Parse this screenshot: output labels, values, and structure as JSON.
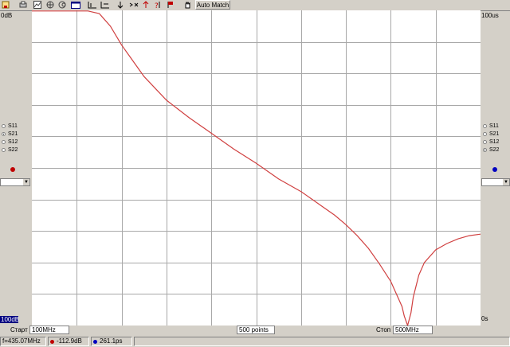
{
  "toolbar": {
    "auto_match_label": "Auto Match",
    "icons": [
      "save-icon",
      "print-icon",
      "chart-icon",
      "polar-icon",
      "smith-icon",
      "table-icon",
      "marker-icon",
      "marker-alt-icon",
      "arrow-down-icon",
      "arrow-cross-icon",
      "arrow-up-icon",
      "help-icon",
      "flag-icon",
      "hand-icon"
    ]
  },
  "left_axis": {
    "top_label": "0dB",
    "bottom_label": "100dB"
  },
  "right_axis": {
    "top_label": "100us",
    "bottom_label": "0s"
  },
  "left_params": {
    "items": [
      "S11",
      "S21",
      "S12",
      "S22"
    ],
    "selected": "S21",
    "marker_color": "#c00000"
  },
  "right_params": {
    "items": [
      "S11",
      "S21",
      "S12",
      "S22"
    ],
    "selected": "S22",
    "marker_color": "#0000c0"
  },
  "sweep": {
    "start_label": "Старт",
    "start_value": "100MHz",
    "points_value": "500 points",
    "stop_label": "Стоп",
    "stop_value": "500MHz"
  },
  "status": {
    "frequency": "f=435.07MHz",
    "magnitude": "-112.9dB",
    "delay": "261.1ps",
    "magnitude_color": "#c00000",
    "delay_color": "#0000c0"
  },
  "chart_data": {
    "type": "line",
    "xlim": [
      100,
      500
    ],
    "ylim": [
      -100,
      0
    ],
    "grid": true,
    "series": [
      {
        "color": "#d04040",
        "x": [
          100,
          150,
          160,
          170,
          180,
          190,
          200,
          220,
          240,
          260,
          280,
          300,
          320,
          340,
          350,
          360,
          370,
          380,
          390,
          400,
          410,
          420,
          430,
          432,
          435,
          438,
          440,
          445,
          450,
          460,
          470,
          480,
          490,
          500
        ],
        "y": [
          -0.2,
          -0.2,
          -1,
          -5,
          -11,
          -16,
          -21,
          -28.5,
          -34,
          -39,
          -44,
          -48.5,
          -53.5,
          -57.5,
          -60,
          -62.5,
          -65,
          -68,
          -71.5,
          -75.5,
          -80.5,
          -86,
          -94,
          -97,
          -100,
          -96,
          -91,
          -84,
          -80,
          -76,
          -74,
          -72.5,
          -71.5,
          -71
        ]
      }
    ]
  }
}
